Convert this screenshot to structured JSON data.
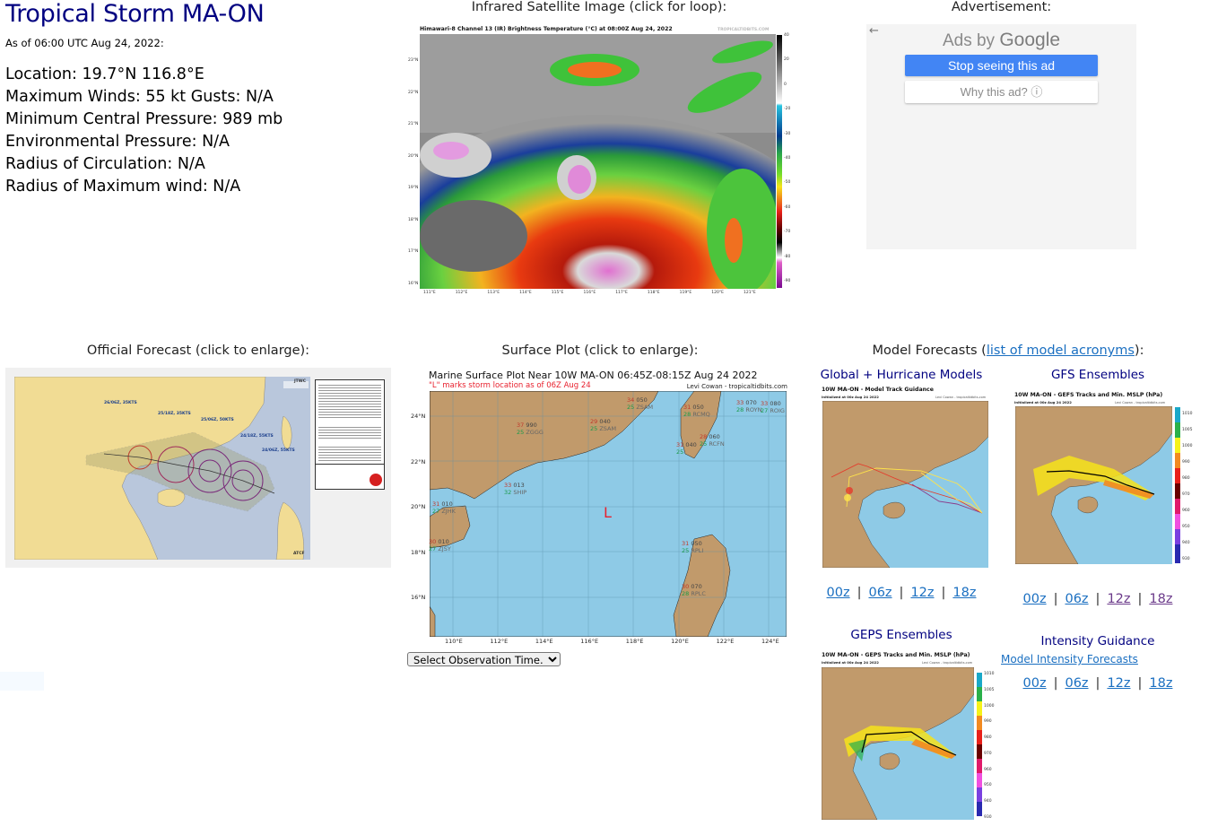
{
  "storm": {
    "title": "Tropical Storm MA-ON",
    "as_of": "As of 06:00 UTC Aug 24, 2022:",
    "details": [
      "Location: 19.7°N 116.8°E",
      "Maximum Winds: 55 kt  Gusts: N/A",
      "Minimum Central Pressure: 989 mb",
      "Environmental Pressure: N/A",
      "Radius of Circulation: N/A",
      "Radius of Maximum wind: N/A"
    ]
  },
  "satellite": {
    "section_title": "Infrared Satellite Image (click for loop):",
    "image_title": "Himawari-8 Channel 13 (IR) Brightness Temperature (°C) at 08:00Z Aug 24, 2022",
    "credit": "TROPICALTIDBITS.COM",
    "lat_ticks": [
      "23°N",
      "22°N",
      "21°N",
      "20°N",
      "19°N",
      "18°N",
      "17°N",
      "16°N"
    ],
    "lon_ticks": [
      "111°E",
      "112°E",
      "113°E",
      "114°E",
      "115°E",
      "116°E",
      "117°E",
      "118°E",
      "119°E",
      "120°E",
      "121°E"
    ],
    "colorbar_ticks": [
      "40",
      "20",
      "0",
      "-20",
      "-30",
      "-40",
      "-50",
      "-60",
      "-70",
      "-80",
      "-90"
    ]
  },
  "advertisement": {
    "section_title": "Advertisement:",
    "back_icon": "←",
    "ads_by": "Ads by",
    "google": "Google",
    "stop_label": "Stop seeing this ad",
    "why_label": "Why this ad? ⓘ"
  },
  "official_forecast": {
    "section_title": "Official Forecast (click to enlarge):",
    "agency_label": "JTWC",
    "source_label": "ATCF",
    "labels": [
      "26/06Z, 35KTS",
      "25/18Z, 35KTS",
      "25/06Z, 50KTS",
      "24/18Z, 55KTS",
      "24/06Z, 55KTS"
    ]
  },
  "surface_plot": {
    "section_title": "Surface Plot (click to enlarge):",
    "title": "Marine Surface Plot Near 10W MA-ON 06:45Z-08:15Z Aug 24 2022",
    "subtitle": "\"L\" marks storm location as of 06Z Aug 24",
    "credit": "Levi Cowan - tropicaltidbits.com",
    "storm_marker": "L",
    "lat_ticks": [
      "24°N",
      "22°N",
      "20°N",
      "18°N",
      "16°N"
    ],
    "lon_ticks": [
      "110°E",
      "112°E",
      "114°E",
      "116°E",
      "118°E",
      "120°E",
      "122°E",
      "124°E"
    ],
    "stations": [
      {
        "temp": "37",
        "pres": "990",
        "dew": "25",
        "id": "ZGGG"
      },
      {
        "temp": "29",
        "pres": "040",
        "dew": "25",
        "id": "ZSAM"
      },
      {
        "temp": "34",
        "pres": "050",
        "dew": "25",
        "id": "ZSAM"
      },
      {
        "temp": "31",
        "pres": "050",
        "dew": "28",
        "id": "RCMQ"
      },
      {
        "temp": "33",
        "pres": "070",
        "dew": "28",
        "id": "ROYN"
      },
      {
        "temp": "33",
        "pres": "080",
        "dew": "27",
        "id": "ROIG"
      },
      {
        "temp": "31",
        "pres": "040",
        "dew": "25",
        "id": ""
      },
      {
        "temp": "28",
        "pres": "060",
        "dew": "25",
        "id": "RCFN"
      },
      {
        "temp": "33",
        "pres": "013",
        "dew": "32",
        "id": "SHIP"
      },
      {
        "temp": "31",
        "pres": "010",
        "dew": "27",
        "id": "ZJHK"
      },
      {
        "temp": "30",
        "pres": "010",
        "dew": "27",
        "id": "ZJSY"
      },
      {
        "temp": "31",
        "pres": "050",
        "dew": "25",
        "id": "RPLI"
      },
      {
        "temp": "30",
        "pres": "070",
        "dew": "28",
        "id": "RPLC"
      }
    ],
    "select_label": "Select Observation Time..."
  },
  "model_forecasts": {
    "section_title_prefix": "Model Forecasts (",
    "section_link": "list of model acronyms",
    "section_title_suffix": "):",
    "global": {
      "title": "Global + Hurricane Models",
      "image_title": "10W MA-ON - Model Track Guidance",
      "image_subtitle": "Initialized at 00z Aug 24 2022",
      "credit": "Levi Cowan - tropicaltidbits.com",
      "runs": [
        "00z",
        "06z",
        "12z",
        "18z"
      ]
    },
    "gfs": {
      "title": "GFS Ensembles",
      "image_title": "10W MA-ON - GEFS Tracks and Min. MSLP (hPa)",
      "image_subtitle": "Initialized at 00z Aug 24 2022",
      "credit": "Levi Cowan - tropicaltidbits.com",
      "colorbar_ticks": [
        "1010",
        "1005",
        "1000",
        "990",
        "980",
        "970",
        "960",
        "950",
        "940",
        "930"
      ],
      "runs": [
        "00z",
        "06z",
        "12z",
        "18z"
      ]
    },
    "geps": {
      "title": "GEPS Ensembles",
      "image_title": "10W MA-ON - GEPS Tracks and Min. MSLP (hPa)",
      "image_subtitle": "Initialized at 00z Aug 24 2022",
      "credit": "Levi Cowan - tropicaltidbits.com",
      "colorbar_ticks": [
        "1010",
        "1005",
        "1000",
        "990",
        "980",
        "970",
        "960",
        "950",
        "940",
        "930"
      ]
    },
    "intensity": {
      "title": "Intensity Guidance",
      "link": "Model Intensity Forecasts",
      "runs": [
        "00z",
        "06z",
        "12z",
        "18z"
      ]
    }
  },
  "colors": {
    "title_navy": "#000080",
    "link_blue": "#1a6fc1",
    "link_visited": "#6b3a8a",
    "ad_button": "#4285f4",
    "land": "#c19a6b",
    "ocean": "#8ecae6",
    "storm_marker": "#e8212e"
  }
}
